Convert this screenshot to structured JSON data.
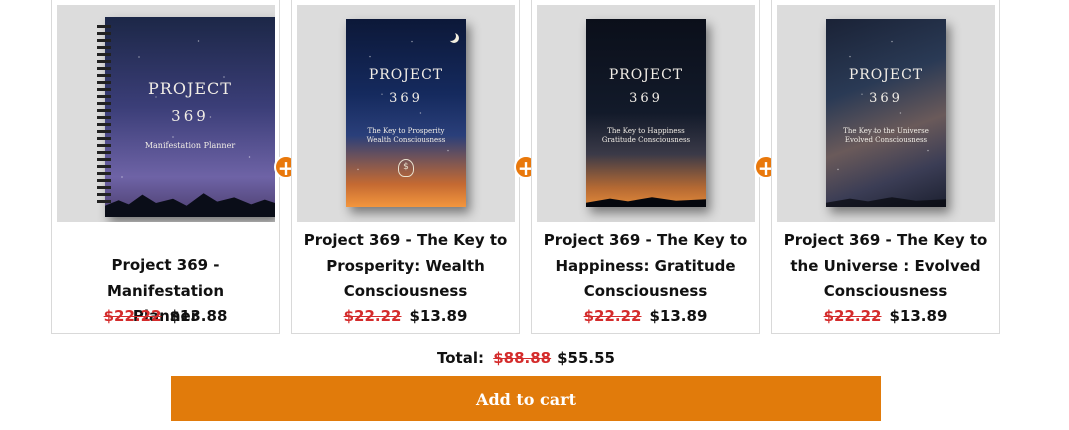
{
  "bundle": {
    "items": [
      {
        "name": "Project 369 - Manifestation Planner",
        "title_lines": [
          "Project 369 - Manifestation",
          "Planner"
        ],
        "original_price": "$22.22",
        "sale_price": "$13.88",
        "cover": {
          "brand": "PROJECT",
          "number": "369",
          "subtitle": "Manifestation Planner",
          "subtitle2": ""
        }
      },
      {
        "name": "Project 369 - The Key to Prosperity: Wealth Consciousness",
        "title_lines": [
          "Project 369 - The Key to",
          "Prosperity: Wealth",
          "Consciousness"
        ],
        "original_price": "$22.22",
        "sale_price": "$13.89",
        "cover": {
          "brand": "PROJECT",
          "number": "369",
          "subtitle": "The Key to Prosperity",
          "subtitle2": "Wealth Consciousness"
        }
      },
      {
        "name": "Project 369 - The Key to Happiness: Gratitude Consciousness",
        "title_lines": [
          "Project 369 - The Key to",
          "Happiness: Gratitude",
          "Consciousness"
        ],
        "original_price": "$22.22",
        "sale_price": "$13.89",
        "cover": {
          "brand": "PROJECT",
          "number": "369",
          "subtitle": "The Key to Happiness",
          "subtitle2": "Gratitude Consciousness"
        }
      },
      {
        "name": "Project 369 - The Key to the Universe : Evolved Consciousness",
        "title_lines": [
          "Project 369 - The Key to",
          "the Universe : Evolved",
          "Consciousness"
        ],
        "original_price": "$22.22",
        "sale_price": "$13.89",
        "cover": {
          "brand": "PROJECT",
          "number": "369",
          "subtitle": "The Key to the Universe",
          "subtitle2": "Evolved Consciousness"
        }
      }
    ],
    "plus_symbol": "+",
    "total_label": "Total:",
    "total_original": "$88.88",
    "total_sale": "$55.55",
    "add_to_cart_label": "Add to cart"
  },
  "colors": {
    "accent": "#e17b0b",
    "strike_price": "#d42b2b",
    "card_border": "#d9d9d9"
  },
  "icons": {
    "bundle_join": "plus-circle-icon"
  }
}
